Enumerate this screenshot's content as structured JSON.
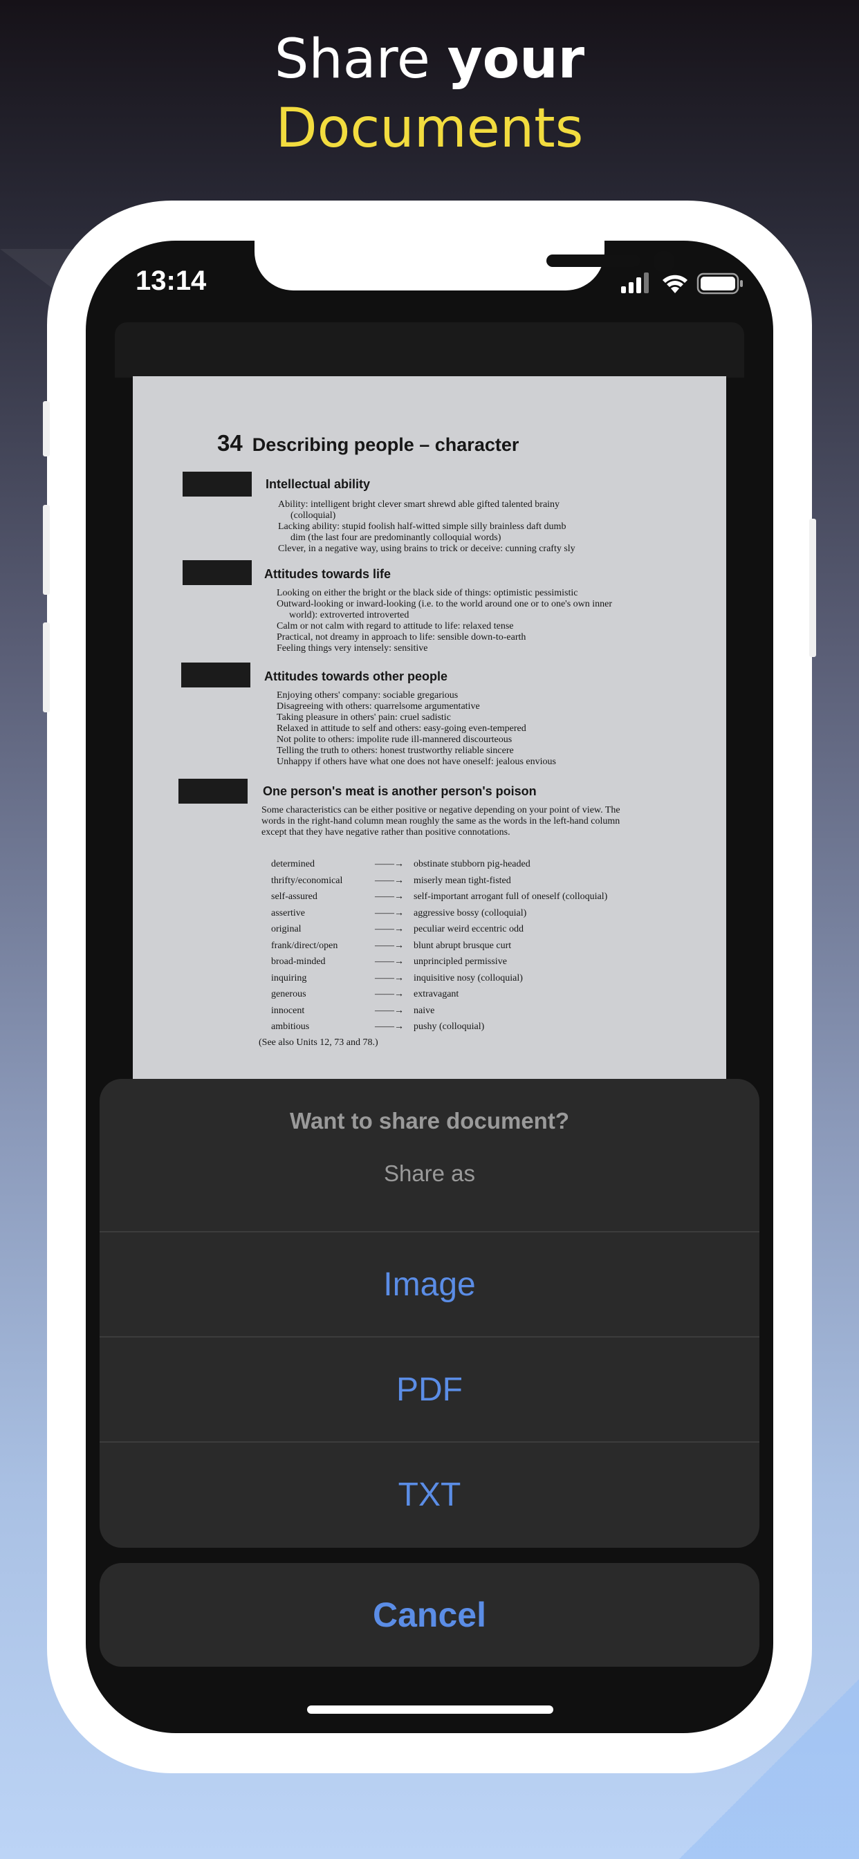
{
  "headline": {
    "line1_thin": "Share",
    "line1_bold": "your",
    "line2": "Documents"
  },
  "status_bar": {
    "time": "13:14",
    "icons": [
      "cellular-signal-icon",
      "wifi-icon",
      "battery-icon"
    ]
  },
  "document": {
    "page_number": "34",
    "title": "Describing people – character",
    "sections": [
      {
        "heading": "Intellectual ability",
        "lines": [
          "Ability: intelligent bright clever smart shrewd able gifted talented brainy",
          "(colloquial)",
          "Lacking ability: stupid foolish half-witted simple silly brainless daft dumb",
          "dim (the last four are predominantly colloquial words)",
          "Clever, in a negative way, using brains to trick or deceive: cunning crafty sly"
        ]
      },
      {
        "heading": "Attitudes towards life",
        "lines": [
          "Looking on either the bright or the black side of things: optimistic pessimistic",
          "Outward-looking or inward-looking (i.e. to the world around one or to one's own inner",
          "world): extroverted introverted",
          "Calm or not calm with regard to attitude to life: relaxed tense",
          "Practical, not dreamy in approach to life: sensible down-to-earth",
          "Feeling things very intensely: sensitive"
        ]
      },
      {
        "heading": "Attitudes towards other people",
        "lines": [
          "Enjoying others' company: sociable gregarious",
          "Disagreeing with others: quarrelsome argumentative",
          "Taking pleasure in others' pain: cruel sadistic",
          "Relaxed in attitude to self and others: easy-going even-tempered",
          "Not polite to others: impolite rude ill-mannered discourteous",
          "Telling the truth to others: honest trustworthy reliable sincere",
          "Unhappy if others have what one does not have oneself: jealous envious"
        ]
      },
      {
        "heading": "One person's meat is another person's poison",
        "lines": [
          "Some characteristics can be either positive or negative depending on your point of view. The",
          "words in the right-hand column mean roughly the same as the words in the left-hand column",
          "except that they have negative rather than positive connotations."
        ]
      }
    ],
    "word_pairs": [
      {
        "left": "determined",
        "arrow": "——→",
        "right": "obstinate stubborn pig-headed"
      },
      {
        "left": "thrifty/economical",
        "arrow": "——→",
        "right": "miserly mean tight-fisted"
      },
      {
        "left": "self-assured",
        "arrow": "——→",
        "right": "self-important arrogant full of oneself (colloquial)"
      },
      {
        "left": "assertive",
        "arrow": "——→",
        "right": "aggressive bossy (colloquial)"
      },
      {
        "left": "original",
        "arrow": "——→",
        "right": "peculiar weird eccentric odd"
      },
      {
        "left": "frank/direct/open",
        "arrow": "——→",
        "right": "blunt abrupt brusque curt"
      },
      {
        "left": "broad-minded",
        "arrow": "——→",
        "right": "unprincipled permissive"
      },
      {
        "left": "inquiring",
        "arrow": "——→",
        "right": "inquisitive nosy (colloquial)"
      },
      {
        "left": "generous",
        "arrow": "——→",
        "right": "extravagant"
      },
      {
        "left": "innocent",
        "arrow": "——→",
        "right": "naive"
      },
      {
        "left": "ambitious",
        "arrow": "——→",
        "right": "pushy (colloquial)"
      }
    ],
    "footer": "(See also Units 12, 73 and 78.)"
  },
  "action_sheet": {
    "title": "Want to share document?",
    "subtitle": "Share as",
    "options": [
      "Image",
      "PDF",
      "TXT"
    ],
    "cancel_label": "Cancel"
  },
  "colors": {
    "accent_yellow": "#f2dc3f",
    "action_blue": "#5b8de6",
    "sheet_bg": "#2a2a2a",
    "muted_text": "#9a9a9a"
  }
}
